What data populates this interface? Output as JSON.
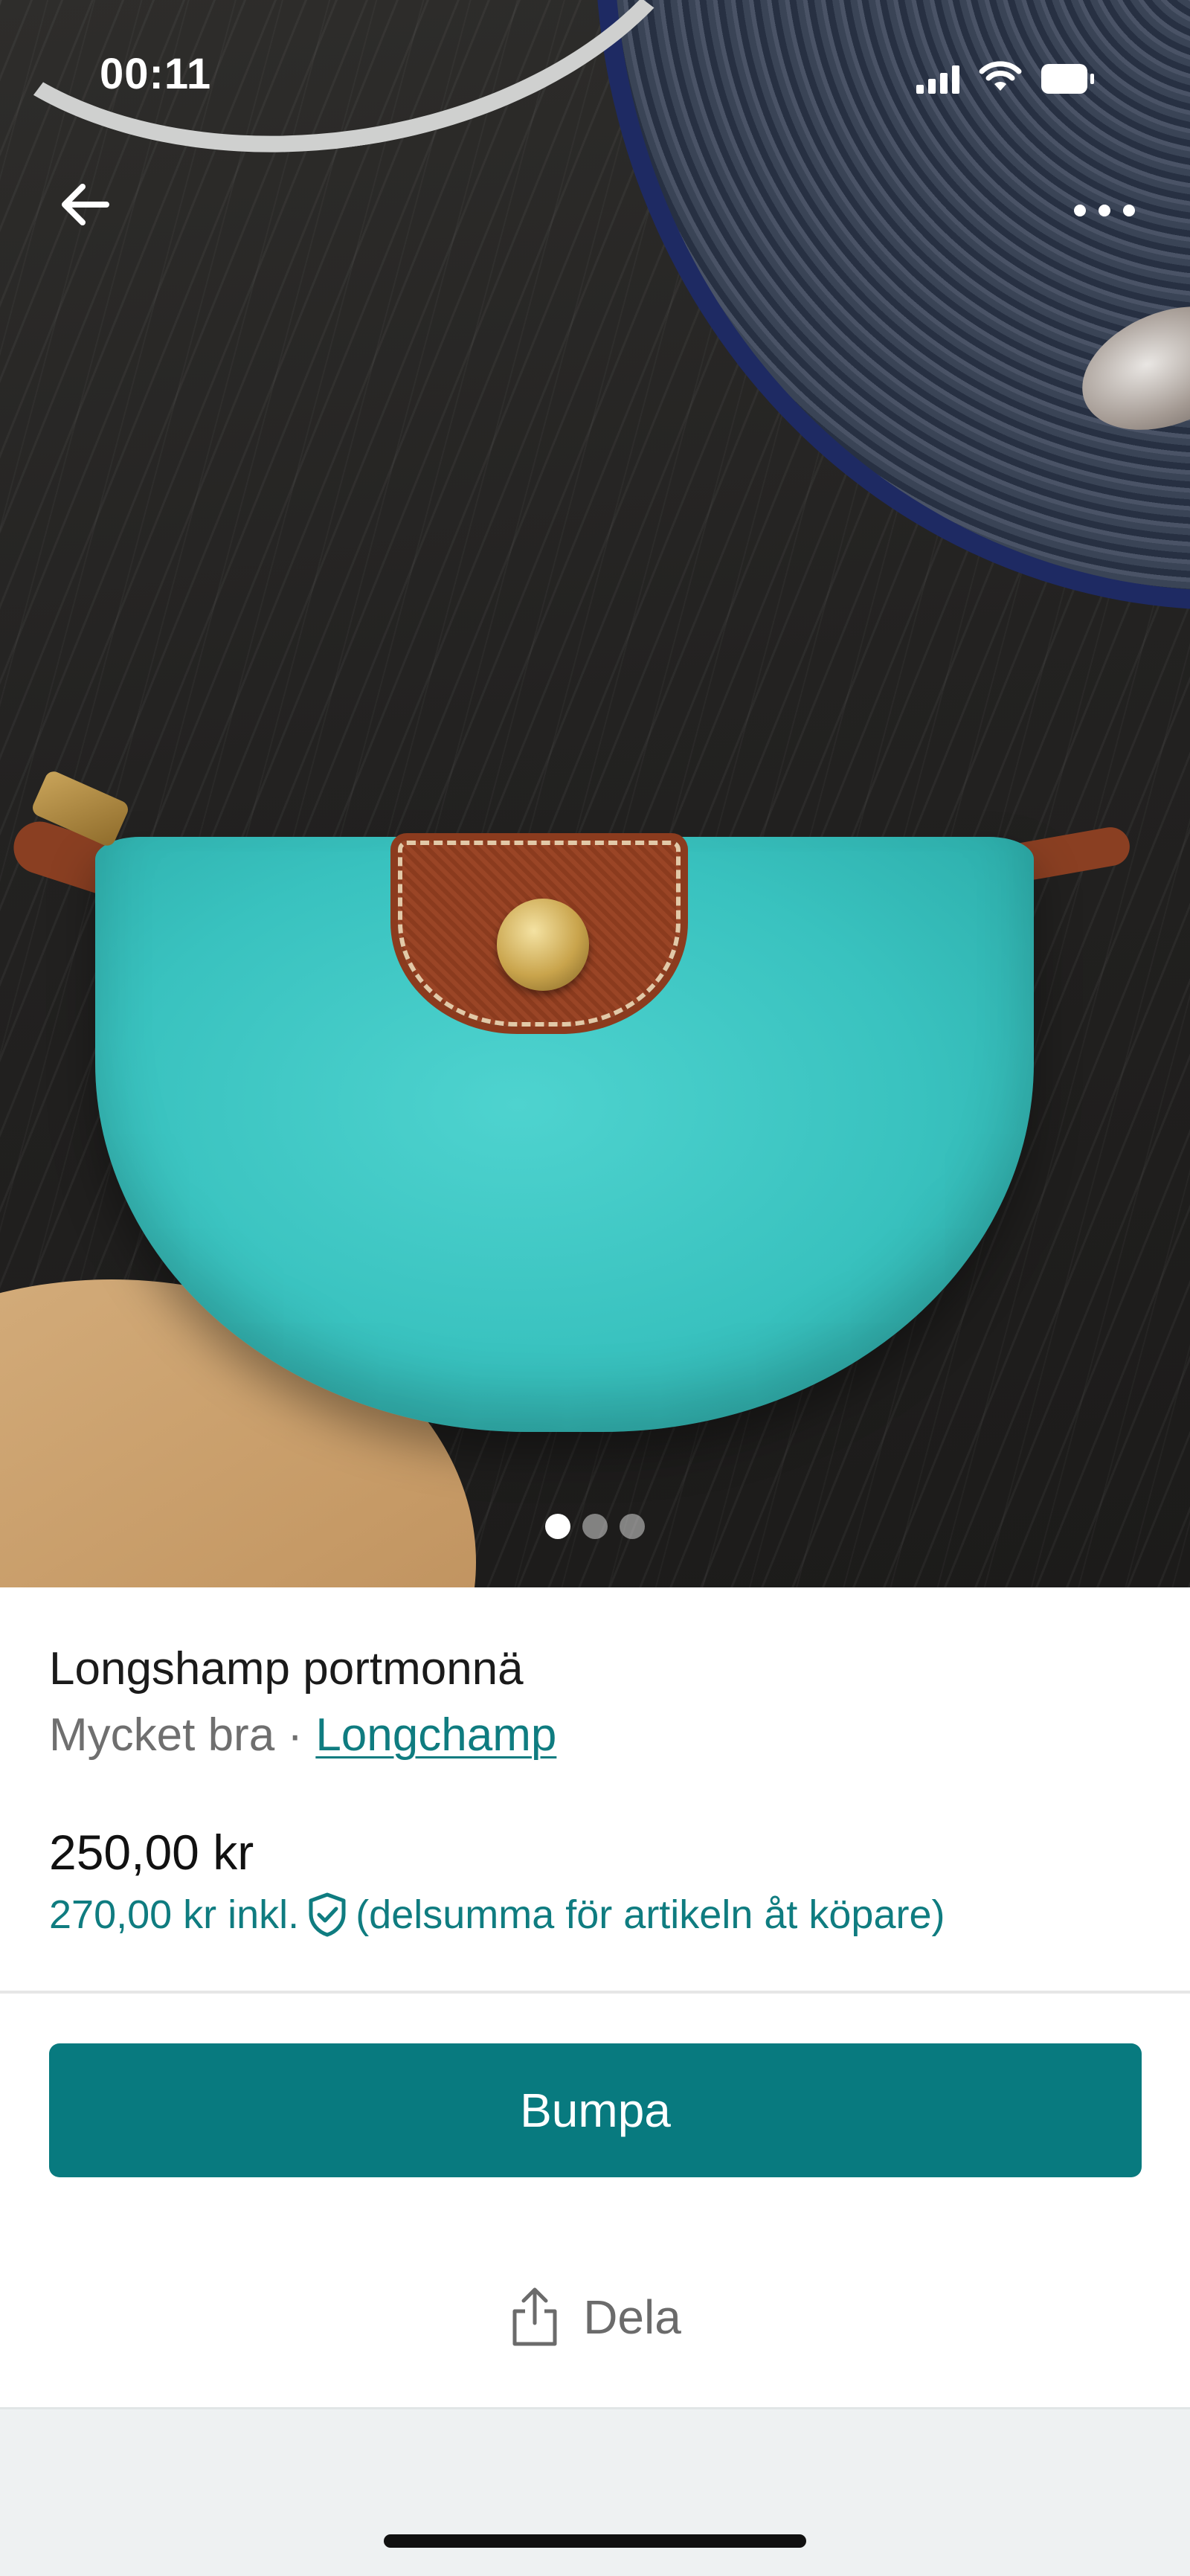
{
  "status_bar": {
    "time": "00:11"
  },
  "gallery": {
    "image_count": 3,
    "active_index": 0
  },
  "listing": {
    "title": "Longshamp portmonnä",
    "condition": "Mycket bra",
    "separator": " · ",
    "brand": "Longchamp",
    "price": "250,00 kr",
    "price_incl": "270,00 kr inkl.",
    "price_incl_note": "(delsumma för artikeln åt köpare)"
  },
  "actions": {
    "bump_label": "Bumpa",
    "share_label": "Dela"
  },
  "colors": {
    "accent": "#087a7f",
    "link": "#0f7c80"
  },
  "icons": {
    "back": "arrow-left-icon",
    "more": "more-horizontal-icon",
    "protection": "shield-check-icon",
    "share": "share-icon"
  }
}
